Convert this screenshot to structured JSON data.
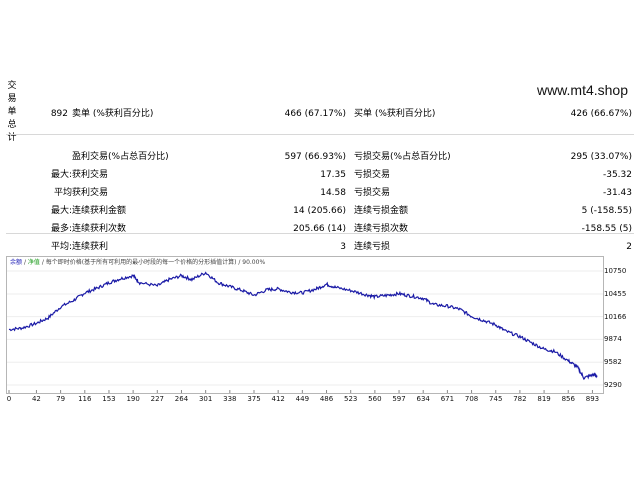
{
  "site": "www.mt4.shop",
  "side_label": [
    "交",
    "易",
    "单",
    "总",
    "计"
  ],
  "rows": [
    {
      "c1": "",
      "c2": "892",
      "c3": "卖单 (%获利百分比)",
      "c4": "466 (67.17%)",
      "c5": "买单 (%获利百分比)",
      "c6": "426 (66.67%)"
    },
    {
      "c1": "",
      "c2": "",
      "c3": "盈利交易(%占总百分比)",
      "c4": "597 (66.93%)",
      "c5": "亏损交易(%占总百分比)",
      "c6": "295 (33.07%)"
    },
    {
      "c1": "最大:",
      "c2": "",
      "c3": "获利交易",
      "c4": "17.35",
      "c5": "亏损交易",
      "c6": "-35.32"
    },
    {
      "c1": "平均",
      "c2": "",
      "c3": "获利交易",
      "c4": "14.58",
      "c5": "亏损交易",
      "c6": "-31.43"
    },
    {
      "c1": "最大:",
      "c2": "",
      "c3": "连续获利金额",
      "c4": "14 (205.66)",
      "c5": "连续亏损金额",
      "c6": "5 (-158.55)"
    },
    {
      "c1": "最多:",
      "c2": "",
      "c3": "连续获利次数",
      "c4": "205.66 (14)",
      "c5": "连续亏损次数",
      "c6": "-158.55 (5)"
    },
    {
      "c1": "平均:",
      "c2": "",
      "c3": "连续获利",
      "c4": "3",
      "c5": "连续亏损",
      "c6": "2"
    }
  ],
  "chart_legend": {
    "balance": "余额",
    "equity": "净值",
    "desc": "每个即时价格(基于所有可利用的最小时段的每一个价格的分形插值计算) / 90.00%"
  },
  "chart_data": {
    "type": "line",
    "x_ticks": [
      "0",
      "42",
      "79",
      "116",
      "153",
      "190",
      "227",
      "264",
      "301",
      "338",
      "375",
      "412",
      "449",
      "486",
      "523",
      "560",
      "597",
      "634",
      "671",
      "708",
      "745",
      "782",
      "819",
      "856",
      "893"
    ],
    "y_ticks": [
      "10750",
      "10455",
      "10166",
      "9874",
      "9582",
      "9290"
    ],
    "ylim": [
      9290,
      10750
    ],
    "xlim": [
      0,
      900
    ],
    "series": [
      {
        "color": "#1a1aa6",
        "x": [
          0,
          20,
          42,
          60,
          79,
          100,
          116,
          135,
          153,
          170,
          190,
          200,
          227,
          245,
          264,
          280,
          301,
          320,
          338,
          357,
          375,
          395,
          412,
          430,
          449,
          470,
          486,
          500,
          523,
          545,
          560,
          580,
          597,
          615,
          634,
          650,
          671,
          690,
          708,
          725,
          745,
          760,
          782,
          800,
          819,
          835,
          856,
          870,
          880,
          893,
          900
        ],
        "values": [
          10000,
          10020,
          10080,
          10150,
          10290,
          10380,
          10470,
          10530,
          10600,
          10650,
          10690,
          10600,
          10560,
          10640,
          10690,
          10640,
          10730,
          10600,
          10550,
          10500,
          10440,
          10510,
          10520,
          10480,
          10470,
          10520,
          10580,
          10540,
          10500,
          10450,
          10420,
          10440,
          10460,
          10430,
          10400,
          10320,
          10300,
          10260,
          10170,
          10120,
          10060,
          9980,
          9910,
          9830,
          9750,
          9720,
          9600,
          9520,
          9380,
          9420,
          9410
        ]
      }
    ]
  }
}
